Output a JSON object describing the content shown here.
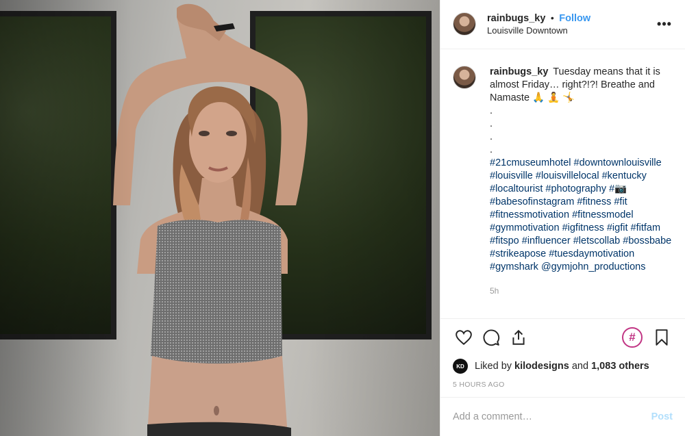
{
  "header": {
    "username": "rainbugs_ky",
    "separator": "•",
    "follow_label": "Follow",
    "location": "Louisville Downtown",
    "more_label": "•••"
  },
  "caption": {
    "username": "rainbugs_ky",
    "text": "Tuesday means that it is almost Friday… right?!?! Breathe and Namaste 🙏 🧘 🤸",
    "dots": [
      ".",
      ".",
      ".",
      "."
    ],
    "hashtags": "#21cmuseumhotel #downtownlouisville #louisville #louisvillelocal #kentucky #localtourist #photography #📷 #babesofinstagram #fitness #fit #fitnessmotivation #fitnessmodel #gymmotivation #igfitness #igfit #fitfam #fitspo #influencer #letscollab #bossbabe #strikeapose #tuesdaymotivation #gymshark @gymjohn_productions",
    "time": "5h"
  },
  "actions": {
    "like_icon": "heart-icon",
    "comment_icon": "comment-icon",
    "share_icon": "share-icon",
    "hashtag_icon": "hashtag-icon",
    "hashtag_label": "#",
    "save_icon": "bookmark-icon"
  },
  "likes": {
    "avatar_label": "KD",
    "prefix": "Liked by",
    "user": "kilodesigns",
    "middle": "and",
    "others": "1,083 others"
  },
  "timestamp": "5 HOURS AGO",
  "comment": {
    "placeholder": "Add a comment…",
    "post_label": "Post"
  },
  "colors": {
    "link": "#003569",
    "follow": "#3897f0",
    "post_disabled": "#b2dffc",
    "hashtag_accent": "#c13584"
  }
}
